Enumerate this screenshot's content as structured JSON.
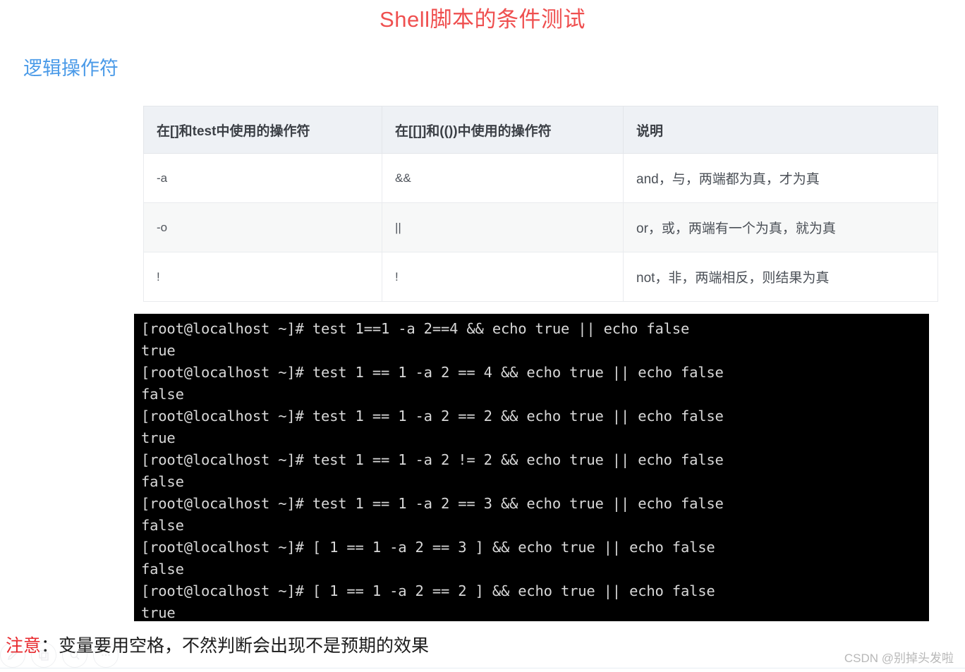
{
  "document": {
    "title": "Shell脚本的条件测试",
    "title_color": "#ef4f4f",
    "section_heading": "逻辑操作符",
    "section_heading_color": "#4a9ae8"
  },
  "table": {
    "headers": [
      "在[]和test中使用的操作符",
      "在[[]]和(())中使用的操作符",
      "说明"
    ],
    "rows": [
      {
        "test_operator": "-a",
        "bracket_operator": "&&",
        "description": "and，与，两端都为真，才为真"
      },
      {
        "test_operator": "-o",
        "bracket_operator": "||",
        "description": "or，或，两端有一个为真，就为真"
      },
      {
        "test_operator": "!",
        "bracket_operator": "!",
        "description": "not，非，两端相反，则结果为真"
      }
    ],
    "header_bg": "#eef1f5",
    "stripe_bg": "#f7f8f8"
  },
  "terminal": {
    "background": "#000000",
    "text_color": "#d8d8d8",
    "lines": [
      "[root@localhost ~]# test 1==1 -a 2==4 && echo true || echo false",
      "true",
      "[root@localhost ~]# test 1 == 1 -a 2 == 4 && echo true || echo false",
      "false",
      "[root@localhost ~]# test 1 == 1 -a 2 == 2 && echo true || echo false",
      "true",
      "[root@localhost ~]# test 1 == 1 -a 2 != 2 && echo true || echo false",
      "false",
      "[root@localhost ~]# test 1 == 1 -a 2 == 3 && echo true || echo false",
      "false",
      "[root@localhost ~]# [ 1 == 1 -a 2 == 3 ] && echo true || echo false",
      "false",
      "[root@localhost ~]# [ 1 == 1 -a 2 == 2 ] && echo true || echo false",
      "true"
    ]
  },
  "footer": {
    "warning_label": "注意",
    "note_text": "：变量要用空格，不然判断会出现不是预期的效果",
    "warning_color": "#e8272c"
  },
  "watermark": {
    "text": "CSDN @别掉头发啦"
  },
  "mini_toolbar": {
    "items": [
      {
        "icon": "pen-icon"
      },
      {
        "icon": "copy-icon"
      },
      {
        "icon": "search-icon"
      },
      {
        "icon": "more-icon"
      }
    ]
  }
}
